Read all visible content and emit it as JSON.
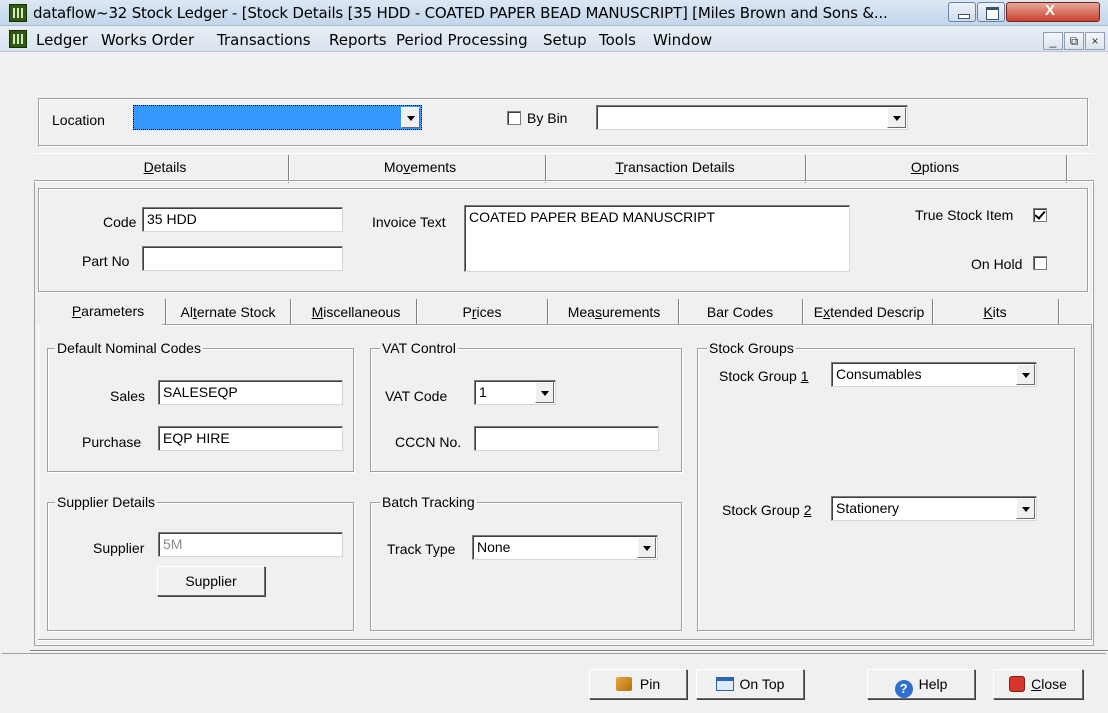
{
  "window": {
    "title": "dataflow~32 Stock Ledger - [Stock Details [35 HDD - COATED PAPER BEAD MANUSCRIPT] [Miles Brown and Sons &..."
  },
  "menu": [
    "Ledger",
    "Works Order",
    "Transactions",
    "Reports",
    "Period Processing",
    "Setup",
    "Tools",
    "Window"
  ],
  "mdi_controls": [
    "_",
    "⧉",
    "×"
  ],
  "location_row": {
    "location_label": "Location",
    "location_value": "",
    "by_bin_label": "By Bin",
    "by_bin_checked": false,
    "bin_value": ""
  },
  "main_tabs": {
    "details": {
      "u": "D",
      "rest": "etails"
    },
    "movements": {
      "pre": "Mo",
      "u": "v",
      "rest": "ements"
    },
    "transaction_details": {
      "u": "T",
      "rest": "ransaction Details"
    },
    "options": {
      "u": "O",
      "rest": "ptions"
    }
  },
  "details": {
    "code_label": "Code",
    "code_value": "35 HDD",
    "part_no_label": "Part No",
    "part_no_value": "",
    "invoice_text_label": "Invoice Text",
    "invoice_text_value": "COATED PAPER BEAD MANUSCRIPT",
    "true_stock_label": "True Stock Item",
    "true_stock_checked": true,
    "on_hold_label": "On Hold",
    "on_hold_checked": false
  },
  "sub_tabs": {
    "parameters": {
      "u": "P",
      "rest": "arameters"
    },
    "alternate_stock": {
      "pre": "Al",
      "u": "t",
      "rest": "ernate Stock"
    },
    "miscellaneous": {
      "u": "M",
      "rest": "iscellaneous"
    },
    "prices": {
      "pre": "P",
      "u": "r",
      "rest": "ices"
    },
    "measurements": {
      "pre": "Mea",
      "u": "s",
      "rest": "urements"
    },
    "bar_codes": "Bar Codes",
    "extended_descrip": {
      "pre": "E",
      "u": "x",
      "rest": "tended Descrip"
    },
    "kits": {
      "u": "K",
      "rest": "its"
    }
  },
  "default_nominal": {
    "title": "Default Nominal Codes",
    "sales_label": "Sales",
    "sales_value": "SALESEQP",
    "purchase_label": "Purchase",
    "purchase_value": "EQP HIRE"
  },
  "vat_control": {
    "title": "VAT Control",
    "vat_code_label": "VAT Code",
    "vat_code_value": "1",
    "cccn_label": "CCCN No.",
    "cccn_value": ""
  },
  "stock_groups": {
    "title": "Stock Groups",
    "group1_label": {
      "pre": "Stock Group ",
      "u": "1"
    },
    "group1_value": "Consumables",
    "group2_label": {
      "pre": "Stock Group ",
      "u": "2"
    },
    "group2_value": "Stationery"
  },
  "supplier_details": {
    "title": "Supplier Details",
    "supplier_label": "Supplier",
    "supplier_value": "5M",
    "supplier_button": "Supplier"
  },
  "batch_tracking": {
    "title": "Batch Tracking",
    "track_type_label": "Track Type",
    "track_type_value": "None"
  },
  "footer": {
    "pin_label": "Pin",
    "on_top_label": "On Top",
    "help_label": "Help",
    "close_label": {
      "u": "C",
      "rest": "lose"
    }
  }
}
